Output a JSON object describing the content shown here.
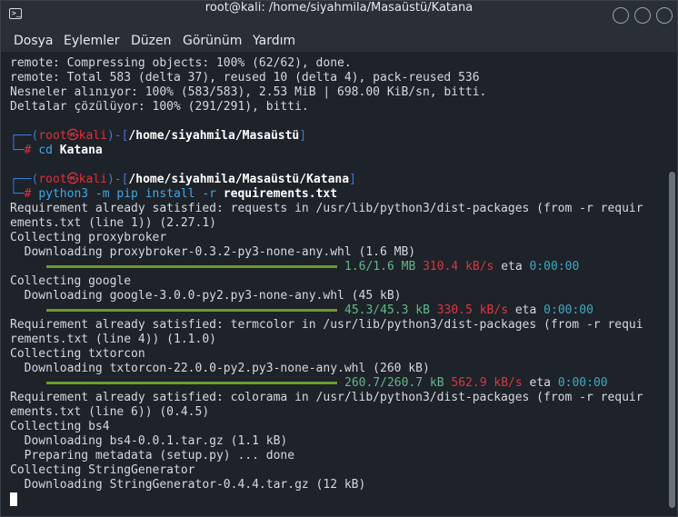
{
  "window": {
    "title": "root@kali: /home/siyahmila/Masaüstü/Katana",
    "icon_label": ">_"
  },
  "menu": [
    "Dosya",
    "Eylemler",
    "Düzen",
    "Görünüm",
    "Yardım"
  ],
  "terminal": {
    "output1": [
      "remote: Compressing objects: 100% (62/62), done.",
      "remote: Total 583 (delta 37), reused 10 (delta 4), pack-reused 536",
      "Nesneler alınıyor: 100% (583/583), 2.53 MiB | 698.00 KiB/sn, bitti.",
      "Deltalar çözülüyor: 100% (291/291), bitti."
    ],
    "prompt1": {
      "left": "┌──(",
      "user": "root㉿kali",
      "mid": ")-[",
      "path": "/home/siyahmila/Masaüstü",
      "end": "]",
      "hash_prefix": "└─",
      "hash": "#",
      "cmd": "cd",
      "arg": "Katana"
    },
    "prompt2": {
      "left": "┌──(",
      "user": "root㉿kali",
      "mid": ")-[",
      "path": "/home/siyahmila/Masaüstü/Katana",
      "end": "]",
      "hash_prefix": "└─",
      "hash": "#",
      "cmd": "python3 -m pip install -r",
      "arg": "requirements.txt"
    },
    "block1": [
      "Requirement already satisfied: requests in /usr/lib/python3/dist-packages (from -r requir",
      "ements.txt (line 1)) (2.27.1)",
      "Collecting proxybroker",
      "  Downloading proxybroker-0.3.2-py3-none-any.whl (1.6 MB)"
    ],
    "progress1": {
      "size": "1.6/1.6 MB",
      "speed": "310.4 kB/s",
      "eta_label": "eta",
      "eta": "0:00:00",
      "fraction": 1.0
    },
    "block2": [
      "Collecting google",
      "  Downloading google-3.0.0-py2.py3-none-any.whl (45 kB)"
    ],
    "progress2": {
      "size": "45.3/45.3 kB",
      "speed": "330.5 kB/s",
      "eta_label": "eta",
      "eta": "0:00:00",
      "fraction": 1.0
    },
    "block3": [
      "Requirement already satisfied: termcolor in /usr/lib/python3/dist-packages (from -r requi",
      "rements.txt (line 4)) (1.1.0)",
      "Collecting txtorcon",
      "  Downloading txtorcon-22.0.0-py2.py3-none-any.whl (260 kB)"
    ],
    "progress3": {
      "size": "260.7/260.7 kB",
      "speed": "562.9 kB/s",
      "eta_label": "eta",
      "eta": "0:00:00",
      "fraction": 1.0
    },
    "block4": [
      "Requirement already satisfied: colorama in /usr/lib/python3/dist-packages (from -r requir",
      "ements.txt (line 6)) (0.4.5)",
      "Collecting bs4",
      "  Downloading bs4-0.0.1.tar.gz (1.1 kB)",
      "  Preparing metadata (setup.py) ... done",
      "Collecting StringGenerator",
      "  Downloading StringGenerator-0.4.4.tar.gz (12 kB)"
    ]
  }
}
